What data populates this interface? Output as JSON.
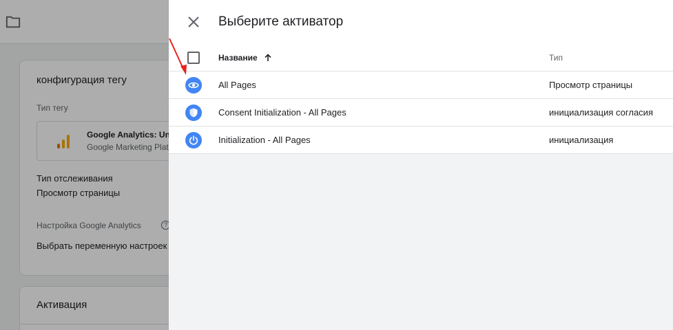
{
  "background": {
    "config_card": {
      "title": "конфигурация тегу",
      "tag_type_label": "Тип тегу",
      "tag_name": "Google Analytics: Universal Analytics",
      "tag_vendor": "Google Marketing Platform",
      "tracking_type_label": "Тип отслеживания",
      "tracking_type_value": "Просмотр страницы",
      "ga_settings_label": "Настройка Google Analytics",
      "ga_settings_value": "Выбрать переменную настроек"
    },
    "triggering_card": {
      "title": "Активация"
    }
  },
  "drawer": {
    "title": "Выберите активатор",
    "columns": {
      "name": "Название",
      "type": "Тип"
    },
    "rows": [
      {
        "name": "All Pages",
        "type": "Просмотр страницы",
        "icon": "eye-icon"
      },
      {
        "name": "Consent Initialization - All Pages",
        "type": "инициализация согласия",
        "icon": "shield-icon"
      },
      {
        "name": "Initialization - All Pages",
        "type": "инициализация",
        "icon": "power-icon"
      }
    ]
  },
  "colors": {
    "accent_blue": "#4285f4",
    "annotation_arrow": "#e8231f",
    "ga_orange": "#f9ab00",
    "ga_dark_orange": "#e37400"
  }
}
